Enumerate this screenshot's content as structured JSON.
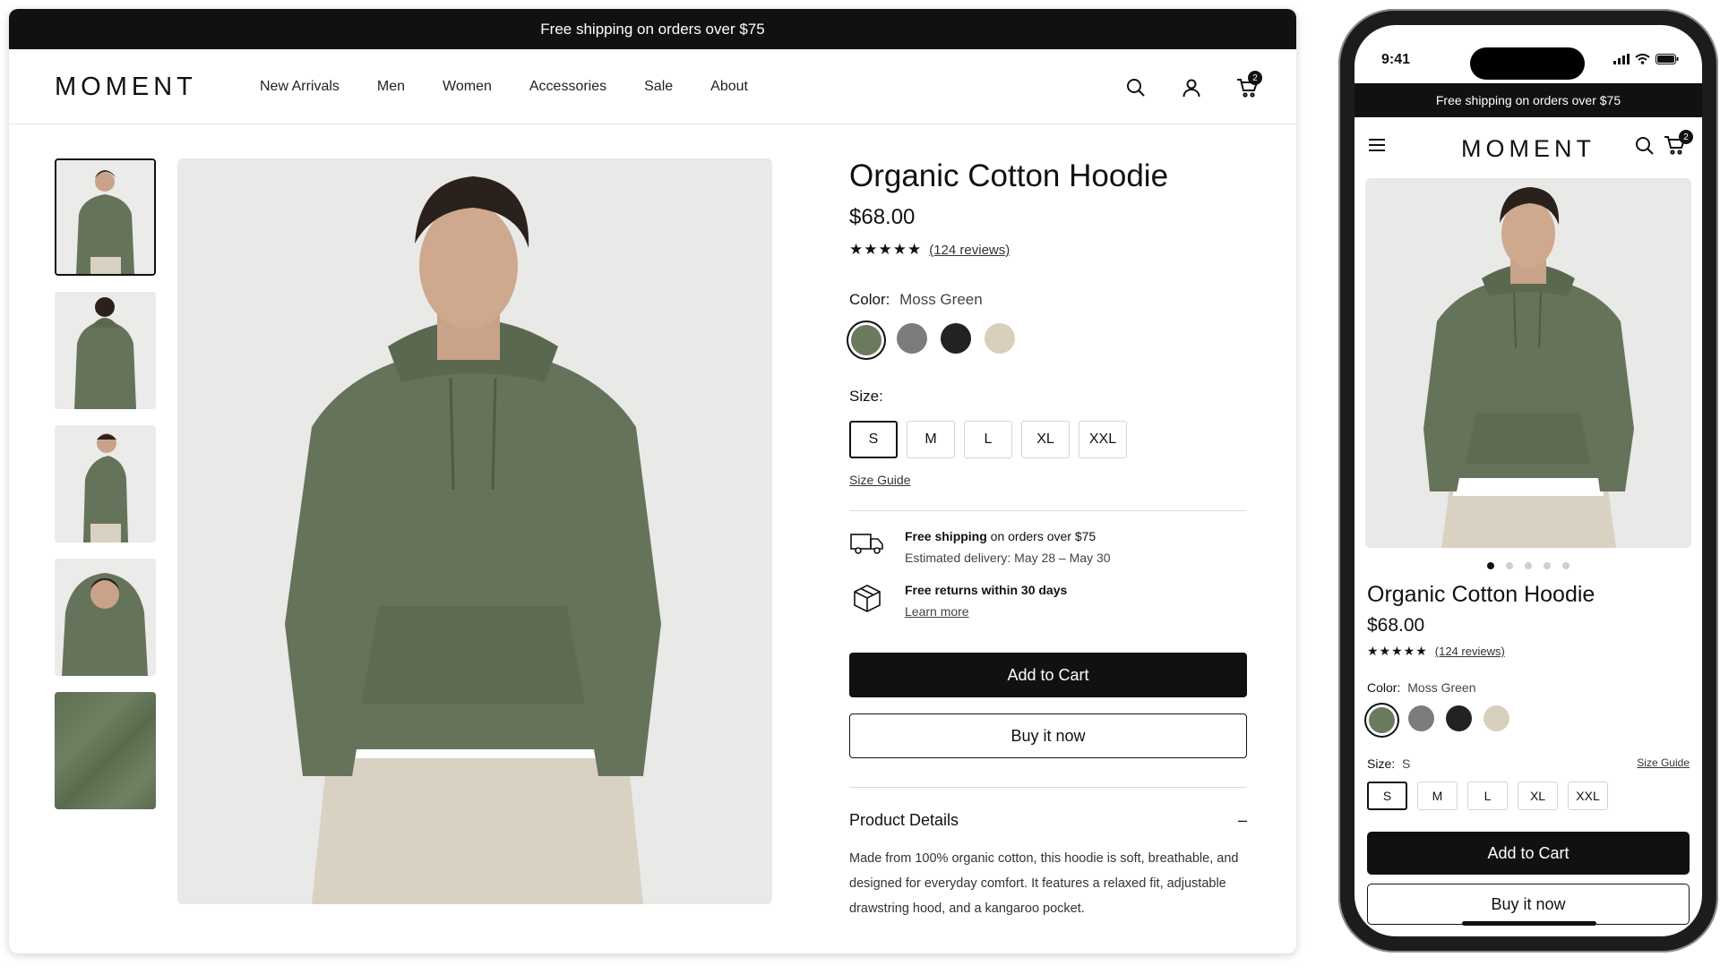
{
  "colors": {
    "accent": "#111111",
    "moss_green": "#6b7a5c",
    "gray": "#7c7c7c",
    "black": "#222222",
    "sand": "#d9cfbd",
    "background": "#e9e9e8"
  },
  "desktop": {
    "promo": "Free shipping on orders over $75",
    "logo": "MOMENT",
    "nav": [
      "New Arrivals",
      "Men",
      "Women",
      "Accessories",
      "Sale",
      "About"
    ],
    "icons": {
      "search": "search-icon",
      "account": "user-icon",
      "cart": "cart-icon"
    },
    "cart_count": "2",
    "thumbnails": [
      "front",
      "back",
      "side",
      "hood-up",
      "fabric"
    ],
    "product": {
      "title": "Organic Cotton Hoodie",
      "price": "$68.00",
      "stars": "★★★★★",
      "reviews": "(124 reviews)",
      "color_label": "Color:",
      "color_value": "Moss Green",
      "size_label": "Size:",
      "sizes": [
        "S",
        "M",
        "L",
        "XL",
        "XXL"
      ],
      "selected_size": "S",
      "size_guide": "Size Guide",
      "shipping_bold": "Free shipping",
      "shipping_rest": " on orders over $75",
      "delivery": "Estimated delivery: May 28 – May 30",
      "returns": "Free returns within 30 days",
      "learn_more": "Learn more",
      "add_to_cart": "Add to Cart",
      "buy_now": "Buy it now",
      "details_title": "Product Details",
      "details_toggle": "–",
      "details_text": "Made from 100% organic cotton, this hoodie is soft, breathable, and designed for everyday comfort. It features a relaxed fit, adjustable drawstring hood, and a kangaroo pocket."
    }
  },
  "mobile": {
    "time": "9:41",
    "promo": "Free shipping on orders over $75",
    "logo": "MOMENT",
    "cart_count": "2",
    "carousel_index": 1,
    "carousel_total": 5,
    "title": "Organic Cotton Hoodie",
    "price": "$68.00",
    "stars": "★★★★★",
    "reviews": "(124 reviews)",
    "color_label": "Color:",
    "color_value": "Moss Green",
    "size_label": "Size:",
    "size_value": "S",
    "size_guide": "Size Guide",
    "sizes": [
      "S",
      "M",
      "L",
      "XL",
      "XXL"
    ],
    "add_to_cart": "Add to Cart",
    "buy_now": "Buy it now"
  }
}
